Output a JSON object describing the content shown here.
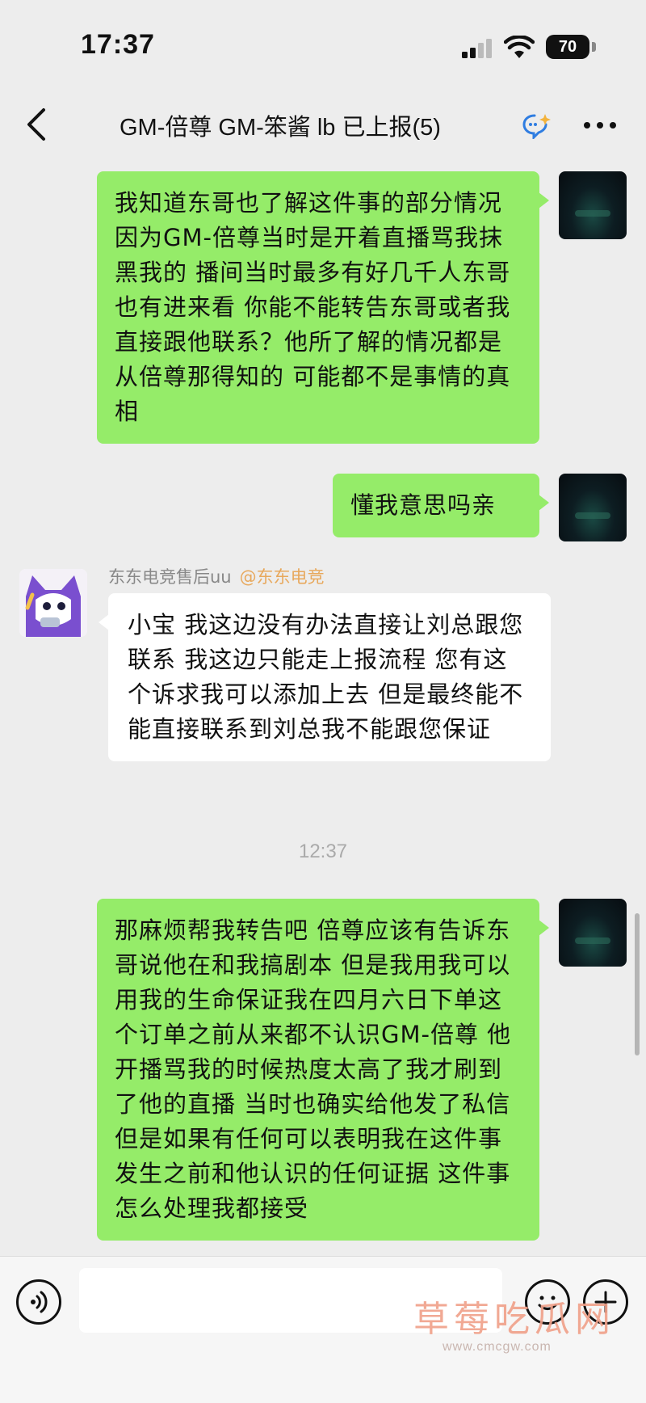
{
  "status_bar": {
    "time": "17:37",
    "battery": "70"
  },
  "nav": {
    "title": "GM-倍尊 GM-笨酱 lb 已上报(5)"
  },
  "messages": [
    {
      "side": "self",
      "text": "我知道东哥也了解这件事的部分情况 因为GM-倍尊当时是开着直播骂我抹黑我的 播间当时最多有好几千人东哥也有进来看 你能不能转告东哥或者我直接跟他联系？他所了解的情况都是从倍尊那得知的 可能都不是事情的真相"
    },
    {
      "side": "self",
      "text": "懂我意思吗亲"
    },
    {
      "side": "other",
      "sender": "东东电竞售后uu",
      "sender_tag": "@东东电竞",
      "text": "小宝 我这边没有办法直接让刘总跟您联系 我这边只能走上报流程 您有这个诉求我可以添加上去 但是最终能不能直接联系到刘总我不能跟您保证"
    },
    {
      "side": "self",
      "text": "那麻烦帮我转告吧 倍尊应该有告诉东哥说他在和我搞剧本 但是我用我可以用我的生命保证我在四月六日下单这个订单之前从来都不认识GM-倍尊 他开播骂我的时候热度太高了我才刷到了他的直播 当时也确实给他发了私信 但是如果有任何可以表明我在这件事发生之前和他认识的任何证据 这件事怎么处理我都接受"
    }
  ],
  "timestamp": "12:37",
  "watermark": {
    "text": "草莓吃瓜网",
    "url": "www.cmcgw.com"
  },
  "colors": {
    "self_bubble": "#95ec69",
    "other_bubble": "#ffffff",
    "background": "#ededed",
    "sender_tag": "#e8a85c"
  }
}
